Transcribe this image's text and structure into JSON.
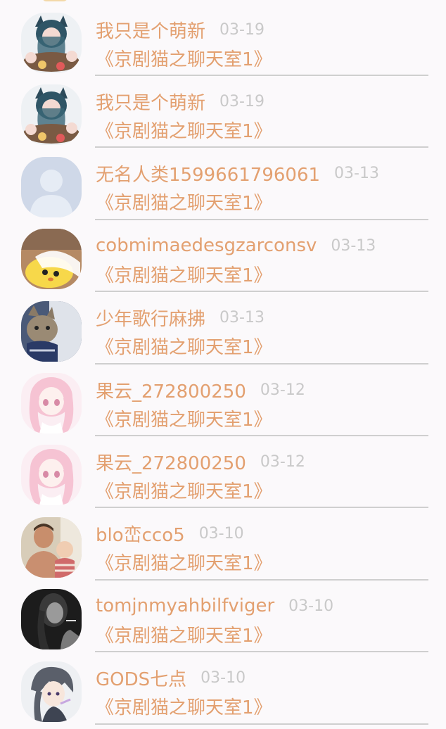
{
  "rows": [
    {
      "name": "我只是个萌新",
      "date": "03-19",
      "message": "《京剧猫之聊天室1》",
      "avatar_icon": "anime-catgirl-group-avatar"
    },
    {
      "name": "我只是个萌新",
      "date": "03-19",
      "message": "《京剧猫之聊天室1》",
      "avatar_icon": "anime-catgirl-group-avatar"
    },
    {
      "name": "无名人类1599661796061",
      "date": "03-13",
      "message": "《京剧猫之聊天室1》",
      "avatar_icon": "default-person-avatar"
    },
    {
      "name": "cobmimaedesgzarconsv",
      "date": "03-13",
      "message": "《京剧猫之聊天室1》",
      "avatar_icon": "yellow-chick-avatar"
    },
    {
      "name": "少年歌行麻拂",
      "date": "03-13",
      "message": "《京剧猫之聊天室1》",
      "avatar_icon": "tabby-cat-avatar"
    },
    {
      "name": "果云_272800250",
      "date": "03-12",
      "message": "《京剧猫之聊天室1》",
      "avatar_icon": "pink-anime-girl-avatar"
    },
    {
      "name": "果云_272800250",
      "date": "03-12",
      "message": "《京剧猫之聊天室1》",
      "avatar_icon": "pink-anime-girl-avatar"
    },
    {
      "name": "blo峦cco5",
      "date": "03-10",
      "message": "《京剧猫之聊天室1》",
      "avatar_icon": "man-with-baby-avatar"
    },
    {
      "name": "tomjnmyahbilfviger",
      "date": "03-10",
      "message": "《京剧猫之聊天室1》",
      "avatar_icon": "monochrome-portrait-avatar"
    },
    {
      "name": "GODS七点",
      "date": "03-10",
      "message": "《京剧猫之聊天室1》",
      "avatar_icon": "anime-boy-avatar"
    }
  ],
  "colors": {
    "name": "#e3a070",
    "date": "#c9c9c9",
    "background": "#fbf9fb",
    "separator": "#cfcfcf"
  }
}
